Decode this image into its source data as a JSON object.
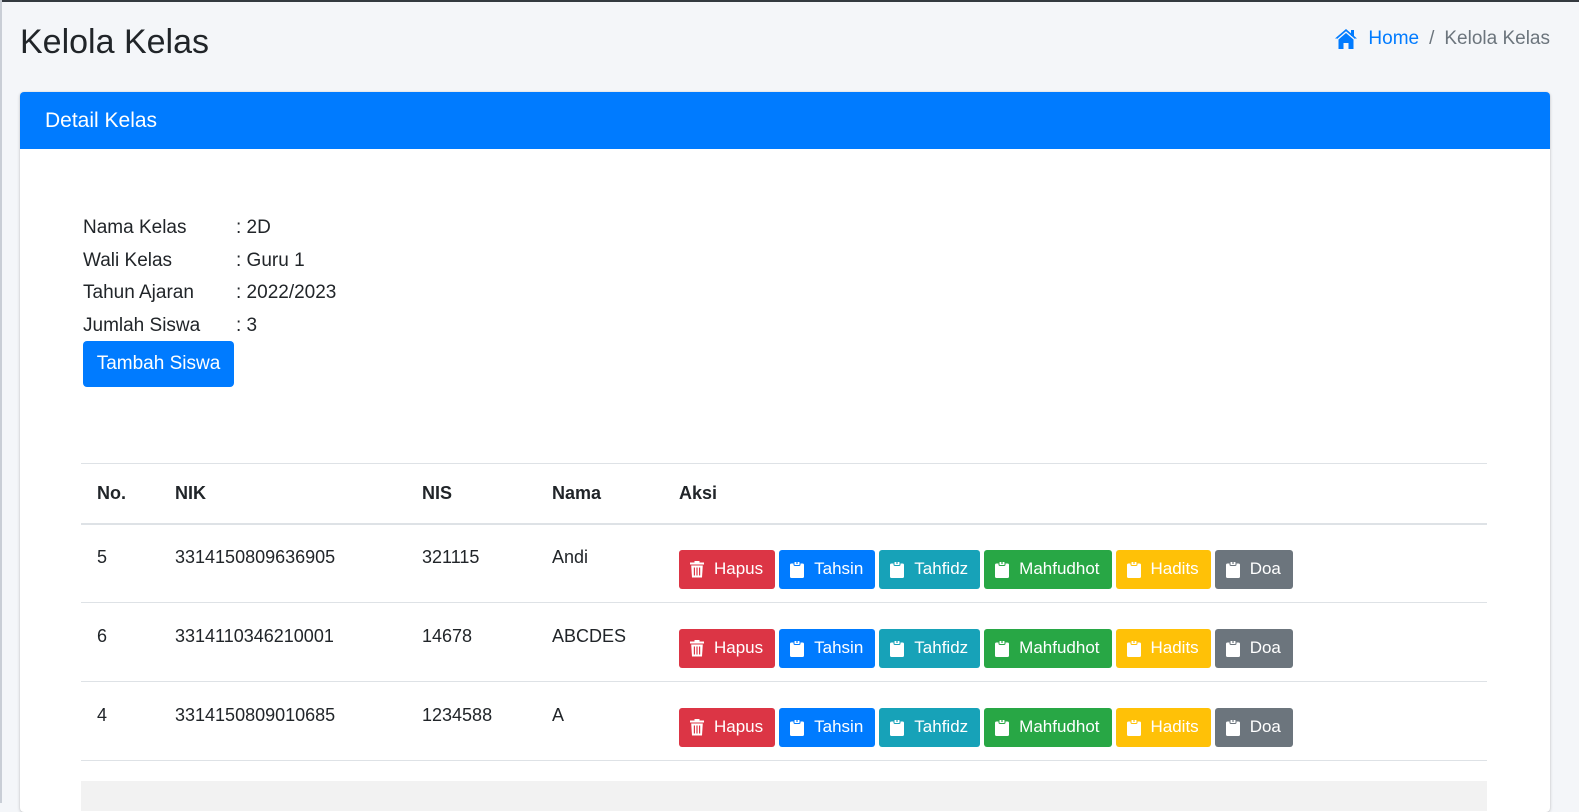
{
  "page": {
    "title": "Kelola Kelas"
  },
  "breadcrumb": {
    "home_icon": "home-icon",
    "home_label": "Home",
    "separator": "/",
    "active_label": "Kelola Kelas"
  },
  "card": {
    "header_title": "Detail Kelas",
    "header_color": "#007bff"
  },
  "class_info": [
    {
      "label": "Nama Kelas",
      "value": ": 2D"
    },
    {
      "label": "Wali Kelas",
      "value": ": Guru 1"
    },
    {
      "label": "Tahun Ajaran",
      "value": ": 2022/2023"
    },
    {
      "label": "Jumlah Siswa",
      "value": ": 3"
    }
  ],
  "add_student_button": "Tambah Siswa",
  "table": {
    "headers": [
      "No.",
      "NIK",
      "NIS",
      "Nama",
      "Aksi"
    ],
    "rows": [
      {
        "no": "5",
        "nik": "3314150809636905",
        "nis": "321115",
        "nama": "Andi"
      },
      {
        "no": "6",
        "nik": "3314110346210001",
        "nis": "14678",
        "nama": "ABCDES"
      },
      {
        "no": "4",
        "nik": "3314150809010685",
        "nis": "1234588",
        "nama": "A"
      }
    ],
    "actions": [
      {
        "label": "Hapus",
        "icon": "trash-icon",
        "color": "#dc3545",
        "style": "danger"
      },
      {
        "label": "Tahsin",
        "icon": "clipboard-icon",
        "color": "#007bff",
        "style": "primary"
      },
      {
        "label": "Tahfidz",
        "icon": "clipboard-icon",
        "color": "#17a2b8",
        "style": "info"
      },
      {
        "label": "Mahfudhot",
        "icon": "clipboard-icon",
        "color": "#28a745",
        "style": "success"
      },
      {
        "label": "Hadits",
        "icon": "clipboard-icon",
        "color": "#ffc107",
        "style": "warning"
      },
      {
        "label": "Doa",
        "icon": "clipboard-icon",
        "color": "#6c757d",
        "style": "secondary"
      }
    ]
  }
}
